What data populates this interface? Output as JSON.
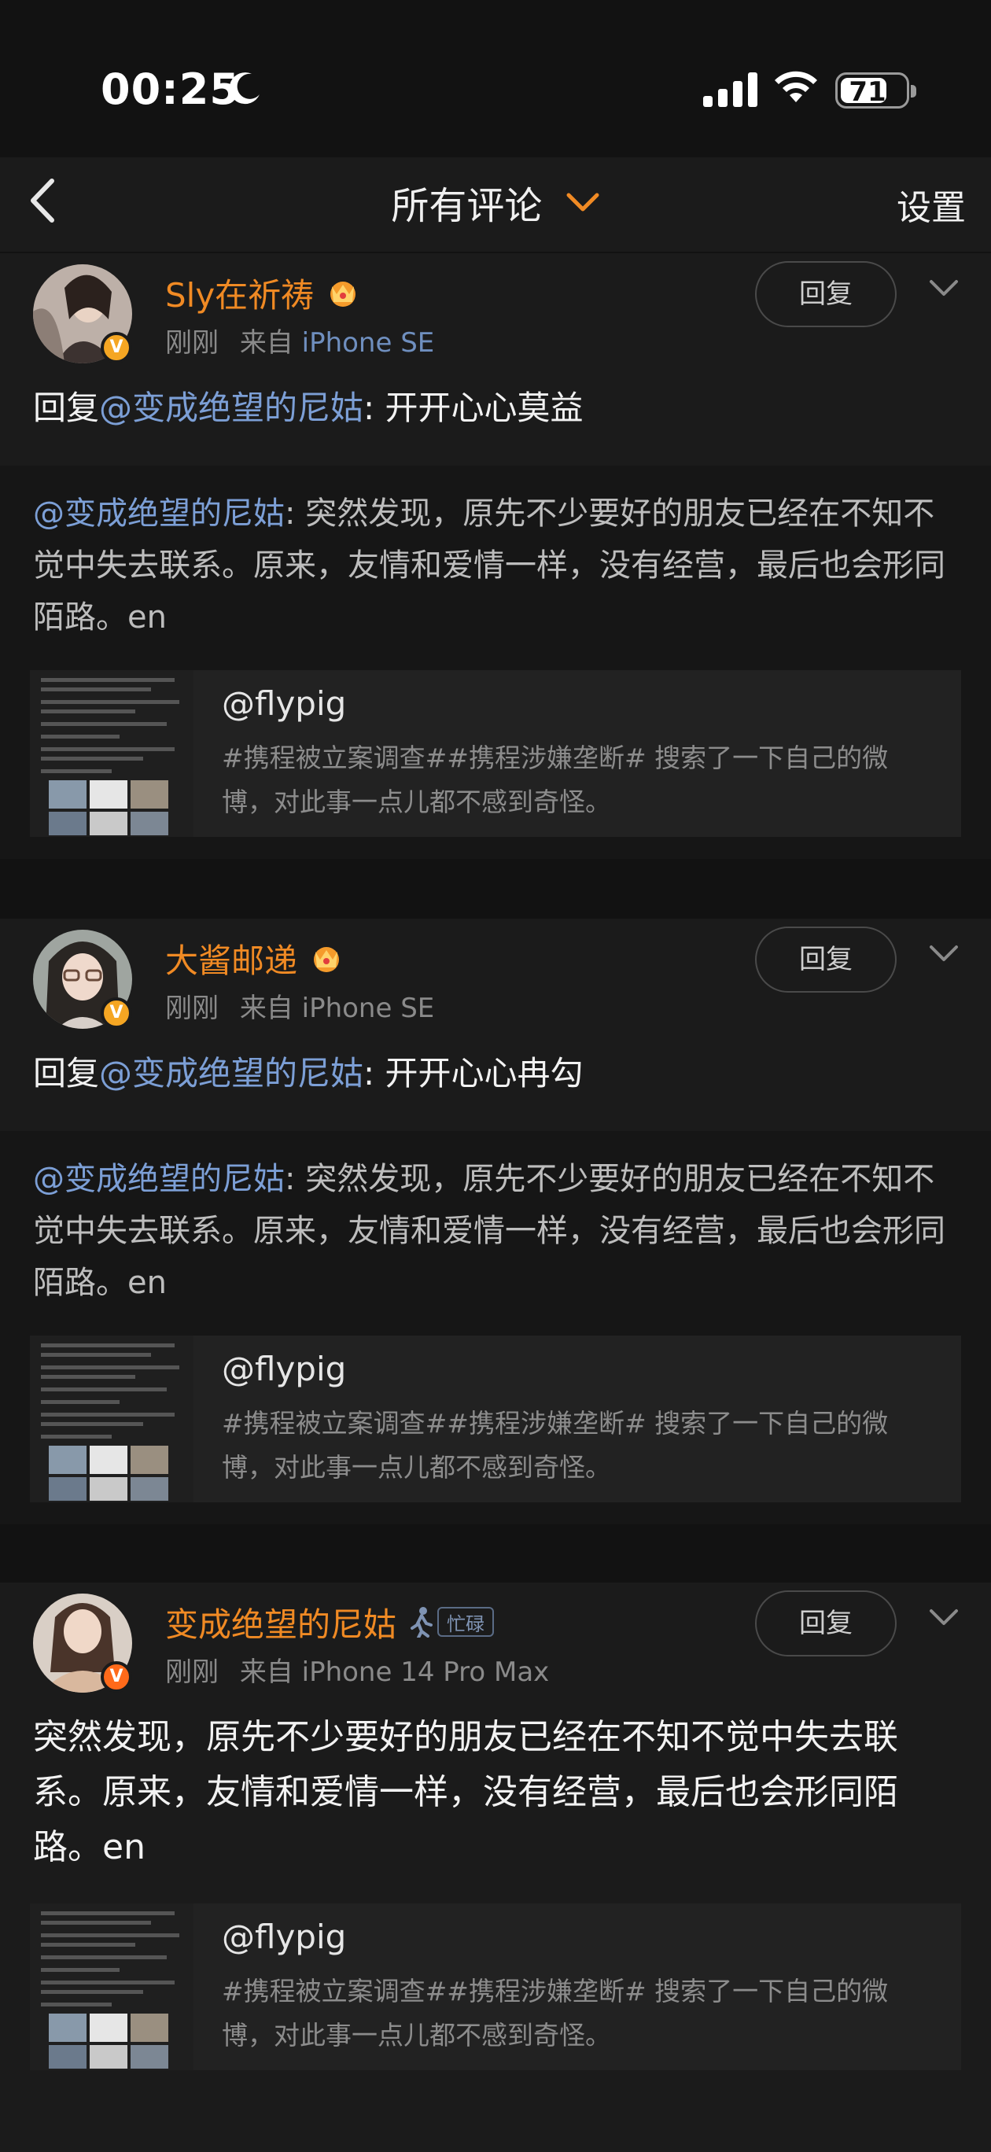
{
  "status_bar": {
    "time": "00:25",
    "battery": "71",
    "battery_level": 0.71,
    "icons": [
      "moon-icon",
      "signal-icon",
      "wifi-icon",
      "battery-icon"
    ]
  },
  "nav": {
    "title": "所有评论",
    "settings": "设置",
    "accent": "#f08a24"
  },
  "comments": [
    {
      "username": "Sly在祈祷",
      "time": "刚刚",
      "source_prefix": "来自",
      "device": "iPhone SE",
      "reply_label": "回复",
      "text_prefix": "回复",
      "text_mention": "@变成绝望的尼姑",
      "text_body": ": 开开心心莫益",
      "quote_mention": "@变成绝望的尼姑",
      "quote_body": ": 突然发现，原先不少要好的朋友已经在不知不觉中失去联系。原来，友情和爱情一样，没有经营，最后也会形同陌路。en",
      "share_title": "@flypig",
      "share_desc": "#携程被立案调查##携程涉嫌垄断# 搜索了一下自己的微博，对此事一点儿都不感到奇怪。"
    },
    {
      "username": "大酱邮递",
      "time": "刚刚",
      "source_prefix": "来自",
      "device": "iPhone SE",
      "reply_label": "回复",
      "text_prefix": "回复",
      "text_mention": "@变成绝望的尼姑",
      "text_body": ": 开开心心冉勾",
      "quote_mention": "@变成绝望的尼姑",
      "quote_body": ": 突然发现，原先不少要好的朋友已经在不知不觉中失去联系。原来，友情和爱情一样，没有经营，最后也会形同陌路。en",
      "share_title": "@flypig",
      "share_desc": "#携程被立案调查##携程涉嫌垄断# 搜索了一下自己的微博，对此事一点儿都不感到奇怪。"
    },
    {
      "username": "变成绝望的尼姑",
      "status_tag": "忙碌",
      "time": "刚刚",
      "source_prefix": "来自",
      "device": "iPhone 14 Pro Max",
      "reply_label": "回复",
      "text_body": "突然发现，原先不少要好的朋友已经在不知不觉中失去联系。原来，友情和爱情一样，没有经营，最后也会形同陌路。en",
      "share_title": "@flypig",
      "share_desc": "#携程被立案调查##携程涉嫌垄断# 搜索了一下自己的微博，对此事一点儿都不感到奇怪。"
    }
  ]
}
